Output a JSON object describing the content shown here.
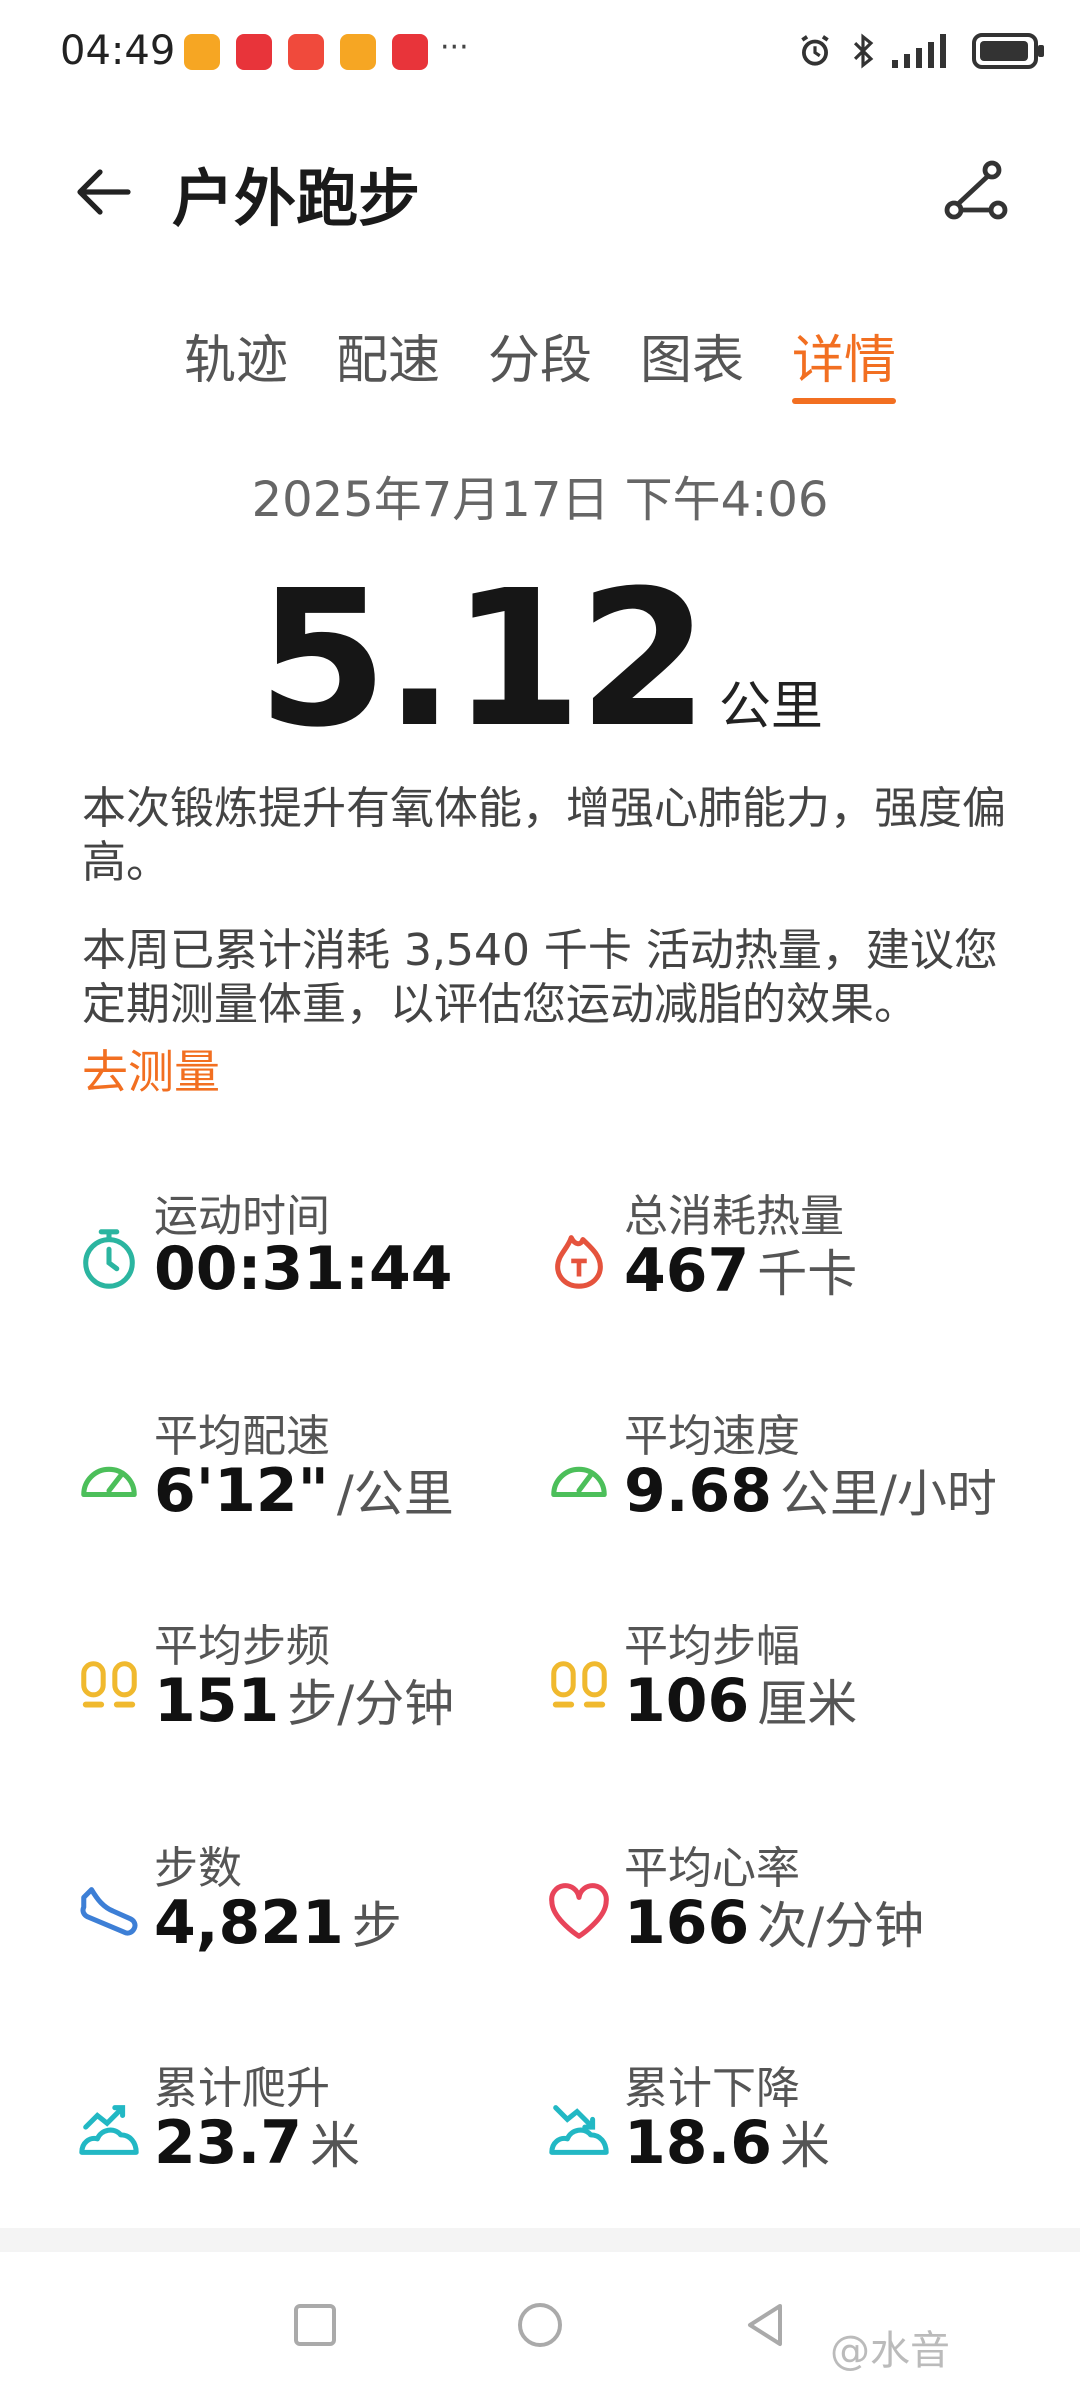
{
  "status_bar": {
    "time": "04:49",
    "more": "···"
  },
  "header": {
    "title": "户外跑步"
  },
  "tabs": [
    {
      "label": "轨迹"
    },
    {
      "label": "配速"
    },
    {
      "label": "分段"
    },
    {
      "label": "图表"
    },
    {
      "label": "详情"
    }
  ],
  "active_tab": "详情",
  "summary": {
    "date": "2025年7月17日  下午4:06",
    "distance_value": "5.12",
    "distance_unit": "公里",
    "description": "本次锻炼提升有氧体能，增强心肺能力，强度偏高。",
    "weekly_note": "本周已累计消耗 3,540 千卡 活动热量，建议您定期测量体重，以评估您运动减脂的效果。",
    "measure_link": "去测量"
  },
  "metrics": [
    {
      "label": "运动时间",
      "value": "00:31:44",
      "unit": ""
    },
    {
      "label": "总消耗热量",
      "value": "467",
      "unit": "千卡"
    },
    {
      "label": "平均配速",
      "value": "6'12\"",
      "unit": "/公里"
    },
    {
      "label": "平均速度",
      "value": "9.68",
      "unit": "公里/小时"
    },
    {
      "label": "平均步频",
      "value": "151",
      "unit": "步/分钟"
    },
    {
      "label": "平均步幅",
      "value": "106",
      "unit": "厘米"
    },
    {
      "label": "步数",
      "value": "4,821",
      "unit": "步"
    },
    {
      "label": "平均心率",
      "value": "166",
      "unit": "次/分钟"
    },
    {
      "label": "累计爬升",
      "value": "23.7",
      "unit": "米"
    },
    {
      "label": "累计下降",
      "value": "18.6",
      "unit": "米"
    }
  ],
  "colors": {
    "accent": "#f26f21",
    "teal": "#2bb5a0",
    "green": "#4cbf5a",
    "yellow": "#f0b92e",
    "blue": "#3d7fd6",
    "red": "#e8445a",
    "cyan": "#22b8c4"
  },
  "watermark": "@水音"
}
